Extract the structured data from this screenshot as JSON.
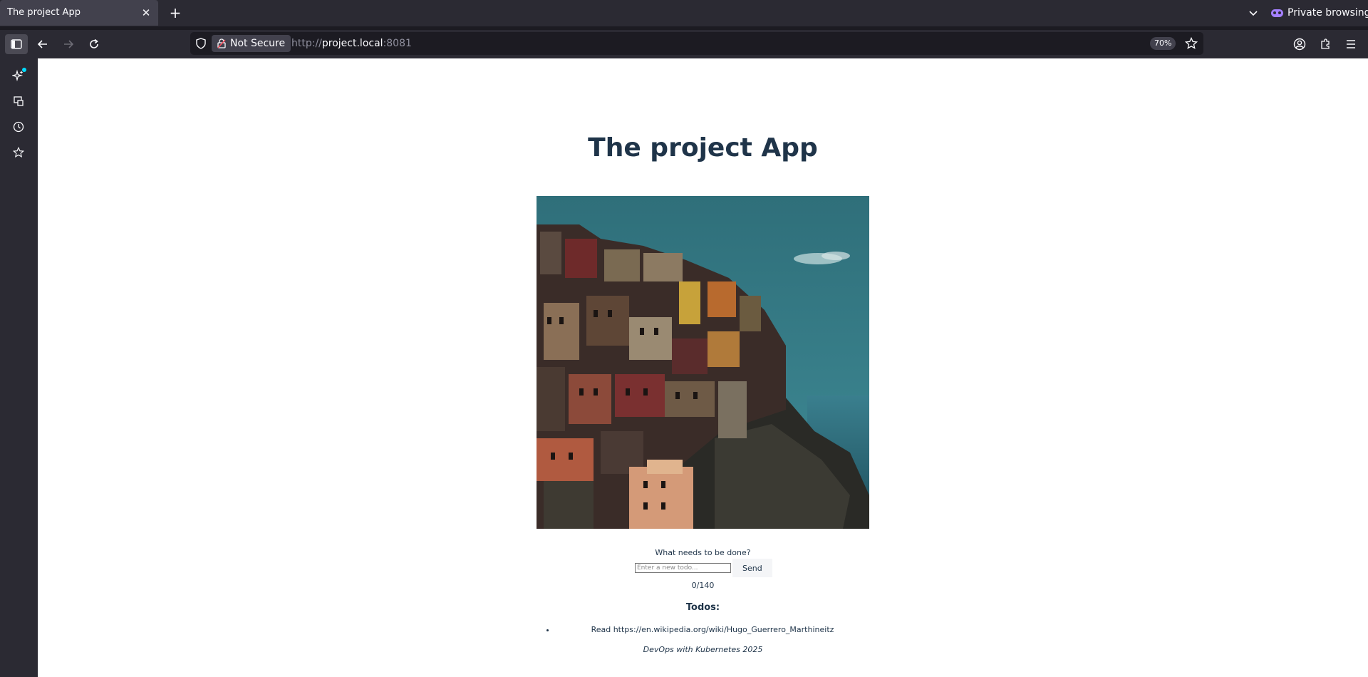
{
  "browser": {
    "tab_title": "The project App",
    "private_label": "Private browsing",
    "security_label": "Not Secure",
    "url_scheme": "http://",
    "url_host": "project.local",
    "url_port": ":8081",
    "zoom": "70%"
  },
  "page": {
    "title": "The project App",
    "prompt": "What needs to be done?",
    "input_placeholder": "Enter a new todo...",
    "send_label": "Send",
    "counter": "0/140",
    "todos_heading": "Todos:",
    "todos": [
      "Read https://en.wikipedia.org/wiki/Hugo_Guerrero_Marthineitz"
    ],
    "footer": "DevOps with Kubernetes 2025"
  },
  "colors": {
    "accent": "#00ddff",
    "private": "#a480ff",
    "heading": "#1f3449"
  }
}
